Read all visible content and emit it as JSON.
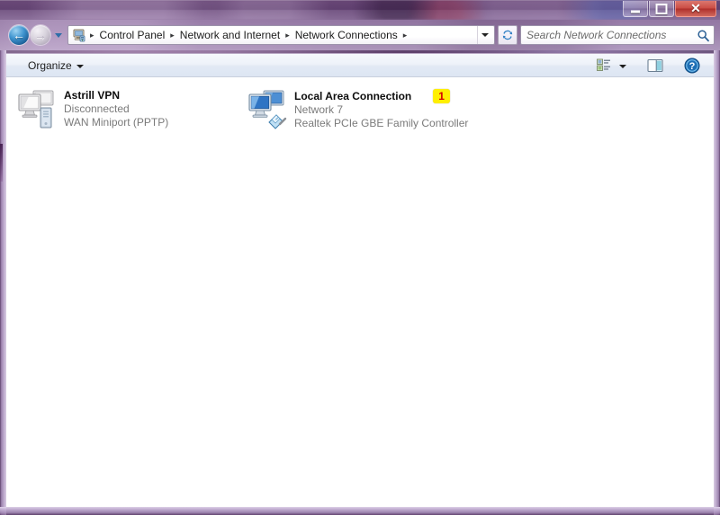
{
  "window": {
    "title": "Network Connections",
    "controls": {
      "minimize_label": "Minimize",
      "maximize_label": "Maximize",
      "close_label": "✕"
    }
  },
  "navbar": {
    "back_label": "←",
    "forward_label": "→",
    "history_dropdown_label": "Recent pages",
    "breadcrumb_icon": "network-folder-icon",
    "breadcrumb": [
      {
        "label": "Control Panel"
      },
      {
        "label": "Network and Internet"
      },
      {
        "label": "Network Connections"
      }
    ],
    "separator": "▸",
    "address_dropdown_label": "Previous locations",
    "refresh_label": "Refresh"
  },
  "search": {
    "value": "",
    "placeholder": "Search Network Connections",
    "icon": "search-icon"
  },
  "toolbar": {
    "organize_label": "Organize",
    "view_options_label": "Change your view",
    "preview_pane_label": "Show the preview pane",
    "help_label": "Get help"
  },
  "connections": [
    {
      "name": "Astrill VPN",
      "status": "Disconnected",
      "device": "WAN Miniport (PPTP)",
      "icon": "vpn-disconnected-icon",
      "badge": ""
    },
    {
      "name": "Local Area Connection",
      "status": "Network  7",
      "device": "Realtek PCIe GBE Family Controller",
      "icon": "lan-connected-icon",
      "badge": "1"
    }
  ],
  "colors": {
    "frame": "#a98cba",
    "titlebar": "#6a4676",
    "badge_background": "#ffef00",
    "badge_text": "#d40000",
    "accent_blue": "#2e6ea8",
    "close_red": "#d04e42"
  }
}
